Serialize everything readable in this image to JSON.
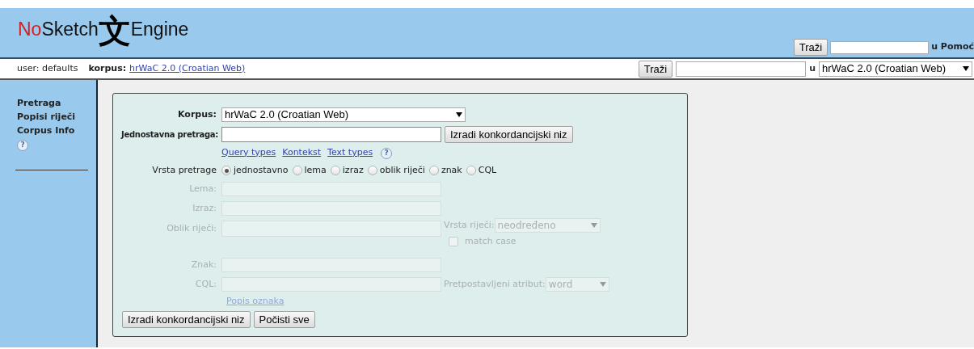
{
  "header": {
    "logo": {
      "no": "No",
      "sketch": "Sketch",
      "glyph": "文",
      "engine": "Engine"
    },
    "help_search": {
      "button": "Traži",
      "suffix": "u Pomoć"
    }
  },
  "toolbar": {
    "user": "user: defaults",
    "corpus_label": "korpus:",
    "corpus_link": "hrWaC 2.0 (Croatian Web)",
    "search_button": "Traži",
    "in": "u",
    "corpus_select": "hrWaC 2.0 (Croatian Web)"
  },
  "sidebar": {
    "items": [
      "Pretraga",
      "Popisi riječi",
      "Corpus Info"
    ],
    "help": "?"
  },
  "form": {
    "corpus": {
      "label": "Korpus:",
      "value": "hrWaC 2.0 (Croatian Web)"
    },
    "simple": {
      "label": "Jednostavna pretraga:",
      "button": "Izradi konkordancijski niz"
    },
    "links": [
      "Query types",
      "Kontekst",
      "Text types"
    ],
    "help": "?",
    "query_type": {
      "label": "Vrsta pretrage",
      "options": [
        {
          "label": "jednostavno",
          "selected": true
        },
        {
          "label": "lema",
          "selected": false
        },
        {
          "label": "izraz",
          "selected": false
        },
        {
          "label": "oblik riječi",
          "selected": false
        },
        {
          "label": "znak",
          "selected": false
        },
        {
          "label": "CQL",
          "selected": false
        }
      ]
    },
    "fields": [
      {
        "kind": "plain",
        "label": "Lema:",
        "disabled": true
      },
      {
        "kind": "plain",
        "label": "Izraz:",
        "disabled": true
      },
      {
        "kind": "wordform",
        "label": "Oblik riječi:",
        "disabled": true,
        "pos_label": "Vrsta riječi:",
        "pos_value": "neodređeno",
        "match_case": {
          "label": "match case",
          "checked": false
        }
      },
      {
        "kind": "plain",
        "label": "Znak:",
        "disabled": true
      },
      {
        "kind": "cql",
        "label": "CQL:",
        "disabled": true,
        "attr_label": "Pretpostavljeni atribut:",
        "attr_value": "word"
      }
    ],
    "tagset_link": "Popis oznaka",
    "buttons": [
      "Izradi konkordancijski niz",
      "Počisti sve"
    ]
  }
}
